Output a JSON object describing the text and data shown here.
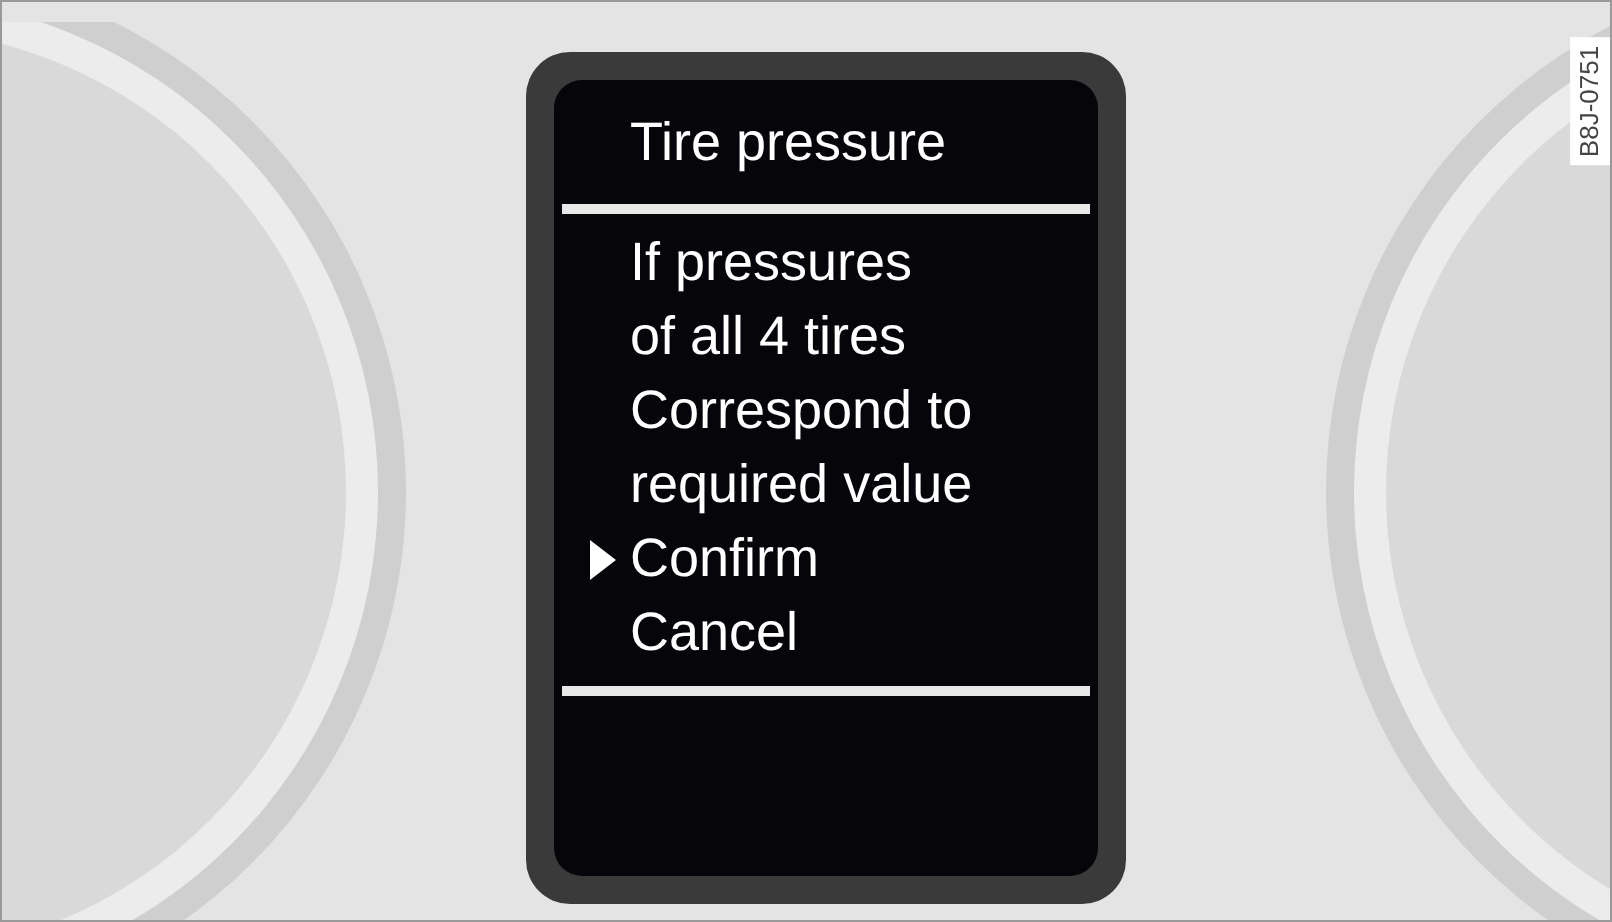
{
  "display": {
    "title": "Tire pressure",
    "message": [
      "If pressures",
      "of all 4 tires",
      "Correspond to",
      "required value"
    ],
    "options": [
      {
        "label": "Confirm",
        "selected": true
      },
      {
        "label": "Cancel",
        "selected": false
      }
    ]
  },
  "figure_code": "B8J-0751"
}
